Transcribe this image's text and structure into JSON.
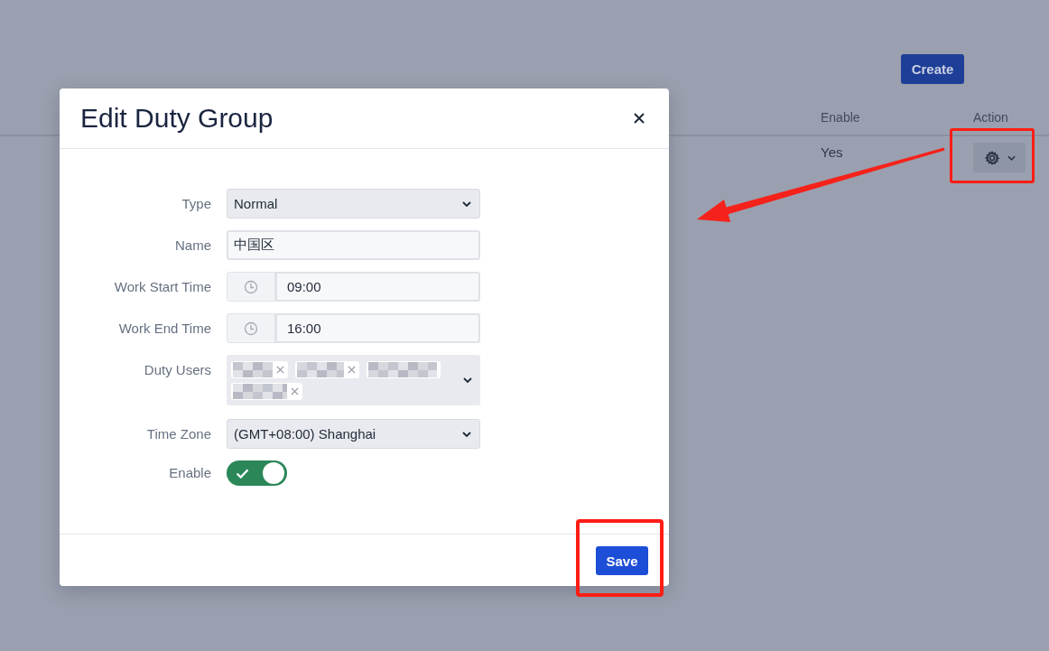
{
  "page": {
    "create_button": "Create"
  },
  "table": {
    "columns": [
      "Enable",
      "Action"
    ],
    "rows": [
      {
        "enable": "Yes",
        "action": {
          "highlighted": true
        }
      }
    ]
  },
  "annotations": [
    {
      "kind": "arrow"
    }
  ],
  "modal": {
    "title": "Edit Duty Group",
    "fields": [
      {
        "kind": "select",
        "label": "Type",
        "value": "Normal"
      },
      {
        "kind": "text",
        "label": "Name",
        "value": "中国区"
      },
      {
        "kind": "time",
        "label": "Work Start Time",
        "value": "09:00"
      },
      {
        "kind": "time",
        "label": "Work End Time",
        "value": "16:00"
      },
      {
        "kind": "tags",
        "label": "Duty Users",
        "tags": [
          {
            "kind": "redacted"
          },
          {
            "kind": "redacted"
          },
          {
            "kind": "covered"
          },
          {
            "kind": "redacted"
          }
        ]
      },
      {
        "kind": "select",
        "label": "Time Zone",
        "value": "(GMT+08:00) Shanghai"
      },
      {
        "kind": "toggle",
        "label": "Enable",
        "on": true
      }
    ],
    "save_button": {
      "label": "Save",
      "highlighted": true
    }
  }
}
